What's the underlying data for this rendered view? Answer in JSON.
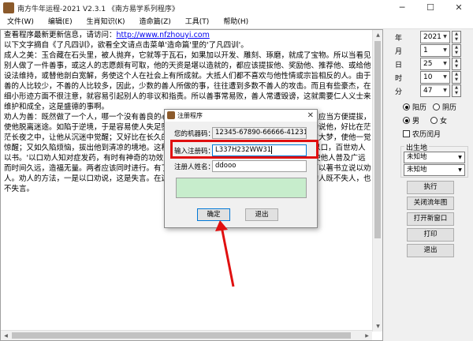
{
  "window": {
    "title": "南方牛年运程-2021   V2.3.1  《南方易学系列程序》",
    "controls": [
      "─",
      "☐",
      "✕"
    ]
  },
  "menu": [
    "文件(W)",
    "编辑(E)",
    "生肖知识(K)",
    "造命篇(Z)",
    "工具(T)",
    "帮助(H)"
  ],
  "text": {
    "line1_prefix": "查看程序最新更新信息，请访问：",
    "line1_link": "http://www.nfzhouyi.com",
    "line2": "",
    "line3": "以下文字摘自《了凡四训》，欲看全文请点击菜单'造命篇'里的'了凡四训'。",
    "line4": "",
    "body": "成人之美：玉合藏在石头里，被人抛弃，它就等于瓦石，如果加以开发、雕刻、琢磨，就成了宝物。所以当看见别人做了一件善事，或这人的志愿颇有可取，他的天资是堪以造就的，都应该提拔他、奖励他、推荐他、或给他设法维持，或替他剖白宽解，务使这个人在社会上有所成就。大抵人们都不喜欢与他性情或宗旨相反的人。由于善的人比较少，不善的人比较多，因此，少数的善人所做的事，往往遭到多数不善人的攻击。而且有些豪杰，在细小形迹方面不很注意，就容易引起别人的非议和指责。所以善事常易败，善人常遭毁谤，这就需要仁人义士来维护和成全，这是盛德的事啊。\n劝人为善：既然做了一个人，哪一个没有善良的心？但世路匆匆，容易堕落。在与人相处之际，应当方便提拔，使他脱离迷途。如陷于逆境，于是容易使人失足堕落。因此，与人相处，应该方便地指引他，劝说他，好比在茫茫长夜之中，让他从沉迷中觉醒；又好比在长久的烦恼之中，把他拉出来，使他清凉。譬如长夜大梦，使他一觉惊醒；又如久陷烦恼，拔出他到清凉的境地。这种恩惠没有比这更大的了。古人说：'一时劝人以口，百世劝人以书。'以口劝人知对症发药，有时有神奇的功效，所以不可废，以书劝人则可以流传于后世，使他人普及广远而时间久远，造福无量。两者应该同时进行。有了机会时，应该以口劝人；在没有机会时，也可以著书立说以劝人。劝人的方法，一是以口劝说，这是失言。在这不同的情况下，应该如以慎重考虑。有智慧的人既不失人，也不失言。"
  },
  "side": {
    "year": {
      "label": "年",
      "value": "2021"
    },
    "month": {
      "label": "月",
      "value": "1"
    },
    "day": {
      "label": "日",
      "value": "25"
    },
    "hour": {
      "label": "时",
      "value": "10"
    },
    "minute": {
      "label": "分",
      "value": "47"
    },
    "calendar": {
      "solar": "阳历",
      "lunar": "阴历",
      "selected": "solar"
    },
    "gender": {
      "male": "男",
      "female": "女",
      "selected": "male"
    },
    "leap_month": "农历闰月",
    "birthplace": {
      "title": "出生地",
      "first": "未知地",
      "second": "未知地"
    },
    "buttons": {
      "run": "执行",
      "close_chart": "关闭流年图",
      "open_window": "打开新窗口",
      "print": "打印",
      "exit": "退出"
    }
  },
  "dialog": {
    "title": "注册程序",
    "machine_label": "您的机器码：",
    "machine_value": "12345-67890-66666-41231",
    "code_label": "输入注册码：",
    "code_value": "L337H232WW31",
    "name_label": "注册人姓名：",
    "name_value": "ddooo",
    "ok": "确定",
    "cancel": "退出"
  },
  "colors": {
    "highlight": "#e01010",
    "message_bg": "#c7edcc",
    "link": "#0000ee"
  }
}
